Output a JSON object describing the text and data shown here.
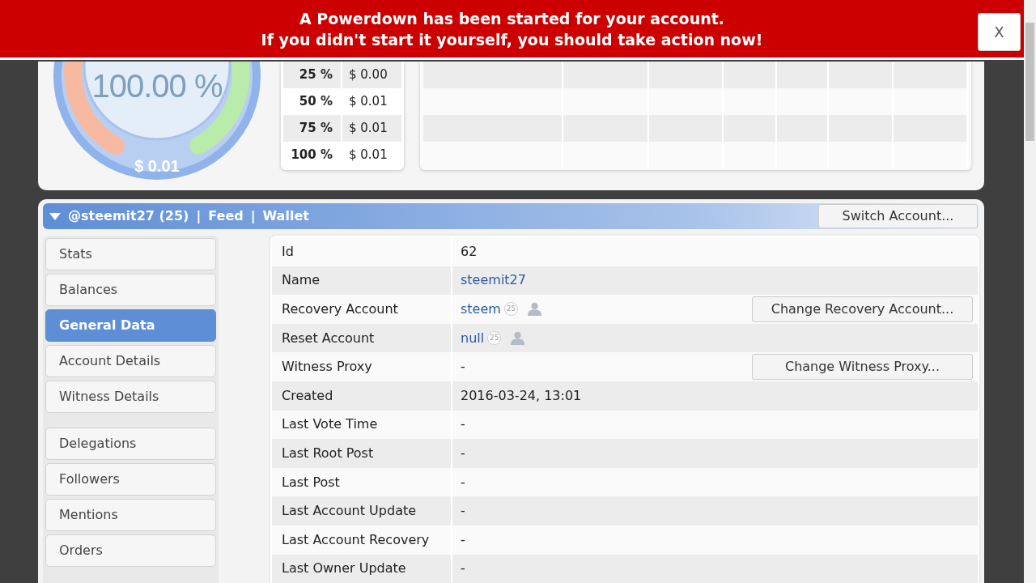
{
  "alert": {
    "lines": [
      "A Powerdown has been started for your account.",
      "If you didn't start it yourself, you should take action now!"
    ],
    "close": "X"
  },
  "gauge": {
    "percent": "100.00 %",
    "value": "$ 0.01"
  },
  "vote_values": [
    {
      "percent": "25 %",
      "value": "$ 0.00"
    },
    {
      "percent": "50 %",
      "value": "$ 0.01"
    },
    {
      "percent": "75 %",
      "value": "$ 0.01"
    },
    {
      "percent": "100 %",
      "value": "$ 0.01"
    }
  ],
  "account_bar": {
    "account": "@steemit27 (25)",
    "links": [
      "Feed",
      "Wallet"
    ],
    "separator": "|",
    "switch_button": "Switch Account..."
  },
  "menu": [
    [
      {
        "label": "Stats",
        "selected": false
      },
      {
        "label": "Balances",
        "selected": false
      },
      {
        "label": "General Data",
        "selected": true
      },
      {
        "label": "Account Details",
        "selected": false
      },
      {
        "label": "Witness Details",
        "selected": false
      }
    ],
    [
      {
        "label": "Delegations",
        "selected": false
      },
      {
        "label": "Followers",
        "selected": false
      },
      {
        "label": "Mentions",
        "selected": false
      },
      {
        "label": "Orders",
        "selected": false
      }
    ]
  ],
  "fields": [
    {
      "label": "Id",
      "kind": "text",
      "value": "62"
    },
    {
      "label": "Name",
      "kind": "link",
      "value": "steemit27"
    },
    {
      "label": "Recovery Account",
      "kind": "account",
      "value": "steem",
      "reputation": "25",
      "button": "Change Recovery Account..."
    },
    {
      "label": "Reset Account",
      "kind": "account",
      "value": "null",
      "reputation": "25"
    },
    {
      "label": "Witness Proxy",
      "kind": "text",
      "value": "-",
      "button": "Change Witness Proxy..."
    },
    {
      "label": "Created",
      "kind": "text",
      "value": "2016-03-24, 13:01"
    },
    {
      "label": "Last Vote Time",
      "kind": "text",
      "value": "-"
    },
    {
      "label": "Last Root Post",
      "kind": "text",
      "value": "-"
    },
    {
      "label": "Last Post",
      "kind": "text",
      "value": "-"
    },
    {
      "label": "Last Account Update",
      "kind": "text",
      "value": "-"
    },
    {
      "label": "Last Account Recovery",
      "kind": "text",
      "value": "-"
    },
    {
      "label": "Last Owner Update",
      "kind": "text",
      "value": "-"
    }
  ]
}
